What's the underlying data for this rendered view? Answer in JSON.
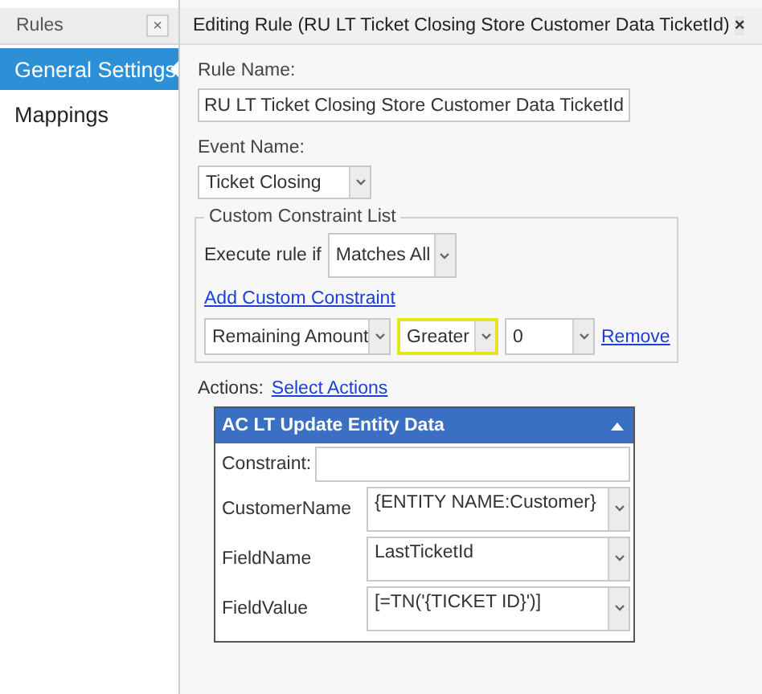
{
  "sidebar": {
    "title": "Rules",
    "close": "×",
    "items": [
      {
        "label": "General Settings",
        "selected": true
      },
      {
        "label": "Mappings",
        "selected": false
      }
    ]
  },
  "editor": {
    "title": "Editing Rule (RU LT Ticket Closing Store Customer Data TicketId)",
    "close": "×",
    "rule_name": {
      "label": "Rule Name:",
      "value": "RU LT Ticket Closing Store Customer Data TicketId"
    },
    "event_name": {
      "label": "Event Name:",
      "value": "Ticket Closing"
    },
    "constraints": {
      "legend": "Custom Constraint List",
      "execute_label": "Execute rule if",
      "execute_value": "Matches All",
      "add_link": "Add Custom Constraint",
      "rows": [
        {
          "field": "Remaining Amount",
          "operator": "Greater",
          "operator_highlighted": true,
          "value": "0",
          "remove": "Remove"
        }
      ]
    },
    "actions": {
      "label": "Actions:",
      "link": "Select Actions",
      "panels": [
        {
          "title": "AC LT Update Entity Data",
          "constraint_label": "Constraint:",
          "fields": [
            {
              "name": "CustomerName",
              "value": "{ENTITY NAME:Customer}"
            },
            {
              "name": "FieldName",
              "value": "LastTicketId"
            },
            {
              "name": "FieldValue",
              "value": "[=TN('{TICKET ID}')]"
            }
          ]
        }
      ]
    }
  }
}
